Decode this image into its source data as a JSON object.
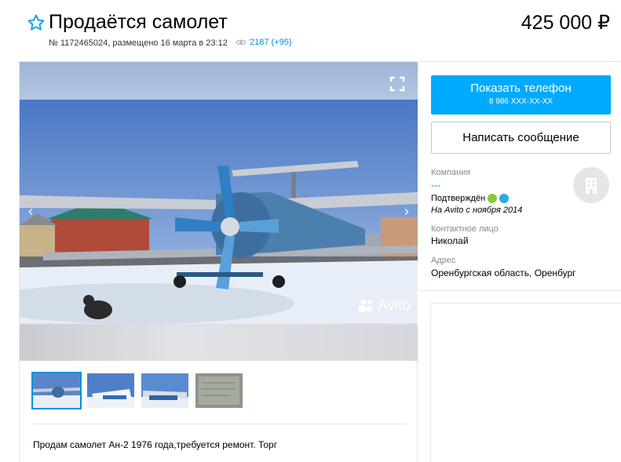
{
  "header": {
    "title": "Продаётся самолет",
    "meta": "№ 1172465024, размещено 16 марта в 23:12",
    "views": "2187 (+95)",
    "price": "425 000 ₽"
  },
  "gallery": {
    "watermark": "Avito",
    "prev_icon": "‹",
    "next_icon": "›"
  },
  "description": "Продам самолет Ан-2 1976 года,требуется ремонт. Торг",
  "contact": {
    "phone_button": "Показать телефон",
    "phone_masked": "8 986 XXX-XX-XX",
    "message_button": "Написать сообщение",
    "company_label": "Компания",
    "company_name": "---",
    "verified": "Подтверждён",
    "since": "На Avito с ноября 2014",
    "contact_label": "Контактное лицо",
    "contact_name": "Николай",
    "address_label": "Адрес",
    "address": "Оренбургская область, Оренбург"
  },
  "colors": {
    "accent": "#00aaff",
    "link": "#0091d9",
    "star": "#1aa3e8",
    "verified_phone": "#8cc63f",
    "verified_email": "#29abe2"
  },
  "icons": [
    "star-icon",
    "eye-icon",
    "expand-icon",
    "chevron-left-icon",
    "chevron-right-icon",
    "avito-logo-icon",
    "building-icon",
    "phone-verified-icon",
    "email-verified-icon"
  ]
}
